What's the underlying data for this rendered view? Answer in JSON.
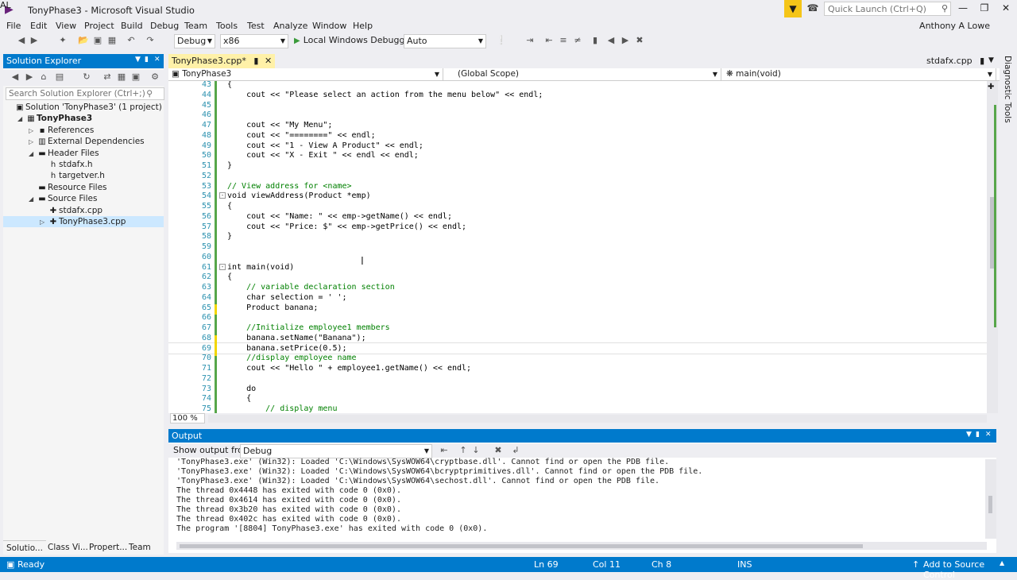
{
  "window": {
    "title": "TonyPhase3 - Microsoft Visual Studio",
    "quick_launch_placeholder": "Quick Launch (Ctrl+Q)",
    "user": "Anthony A Lowe",
    "user_initials": "AL"
  },
  "menu": [
    "File",
    "Edit",
    "View",
    "Project",
    "Build",
    "Debug",
    "Team",
    "Tools",
    "Test",
    "Analyze",
    "Window",
    "Help"
  ],
  "toolbar": {
    "config": "Debug",
    "platform": "x86",
    "debugger": "Local Windows Debugger",
    "debugger_mode": "Auto"
  },
  "solution_explorer": {
    "title": "Solution Explorer",
    "search_placeholder": "Search Solution Explorer (Ctrl+;)",
    "tree": [
      {
        "label": "Solution 'TonyPhase3' (1 project)",
        "icon": "solution-icon",
        "level": 0,
        "expander": ""
      },
      {
        "label": "TonyPhase3",
        "icon": "project-icon",
        "level": 1,
        "expander": "open",
        "bold": true
      },
      {
        "label": "References",
        "icon": "references-icon",
        "level": 2,
        "expander": "closed"
      },
      {
        "label": "External Dependencies",
        "icon": "dependencies-icon",
        "level": 2,
        "expander": "closed"
      },
      {
        "label": "Header Files",
        "icon": "folder-icon",
        "level": 2,
        "expander": "open"
      },
      {
        "label": "stdafx.h",
        "icon": "header-file-icon",
        "level": 3,
        "expander": ""
      },
      {
        "label": "targetver.h",
        "icon": "header-file-icon",
        "level": 3,
        "expander": ""
      },
      {
        "label": "Resource Files",
        "icon": "folder-icon",
        "level": 2,
        "expander": ""
      },
      {
        "label": "Source Files",
        "icon": "folder-icon",
        "level": 2,
        "expander": "open"
      },
      {
        "label": "stdafx.cpp",
        "icon": "cpp-file-icon",
        "level": 3,
        "expander": ""
      },
      {
        "label": "TonyPhase3.cpp",
        "icon": "cpp-file-icon",
        "level": 3,
        "expander": "closed",
        "selected": true
      }
    ],
    "bottom_tabs": [
      "Solutio...",
      "Class Vi...",
      "Propert...",
      "Team E..."
    ]
  },
  "editor": {
    "active_tab": "TonyPhase3.cpp*",
    "right_tab": "stdafx.cpp",
    "nav_project": "TonyPhase3",
    "nav_scope": "(Global Scope)",
    "nav_member": "main(void)",
    "zoom": "100 %",
    "lines": [
      {
        "n": "43",
        "code": "{"
      },
      {
        "n": "44",
        "code": "    cout << \"Please select an action from the menu below\" << endl;"
      },
      {
        "n": "45",
        "code": ""
      },
      {
        "n": "46",
        "code": ""
      },
      {
        "n": "47",
        "code": "    cout << \"My Menu\";"
      },
      {
        "n": "48",
        "code": "    cout << \"========\" << endl;"
      },
      {
        "n": "49",
        "code": "    cout << \"1 - View A Product\" << endl;"
      },
      {
        "n": "50",
        "code": "    cout << \"X - Exit \" << endl << endl;"
      },
      {
        "n": "51",
        "code": "}"
      },
      {
        "n": "52",
        "code": ""
      },
      {
        "n": "53",
        "code": "// View address for <name>"
      },
      {
        "n": "54",
        "code": "void viewAddress(Product *emp)"
      },
      {
        "n": "55",
        "code": "{"
      },
      {
        "n": "56",
        "code": "    cout << \"Name: \" << emp->getName() << endl;"
      },
      {
        "n": "57",
        "code": "    cout << \"Price: $\" << emp->getPrice() << endl;"
      },
      {
        "n": "58",
        "code": "}"
      },
      {
        "n": "59",
        "code": ""
      },
      {
        "n": "60",
        "code": ""
      },
      {
        "n": "61",
        "code": "int main(void)"
      },
      {
        "n": "62",
        "code": "{"
      },
      {
        "n": "63",
        "code": "    // variable declaration section"
      },
      {
        "n": "64",
        "code": "    char selection = ' ';"
      },
      {
        "n": "65",
        "code": "    Product banana;"
      },
      {
        "n": "66",
        "code": ""
      },
      {
        "n": "67",
        "code": "    //Initialize employee1 members"
      },
      {
        "n": "68",
        "code": "    banana.setName(\"Banana\");"
      },
      {
        "n": "69",
        "code": "    banana.setPrice(0.5);"
      },
      {
        "n": "70",
        "code": "    //display employee name"
      },
      {
        "n": "71",
        "code": "    cout << \"Hello \" + employee1.getName() << endl;"
      },
      {
        "n": "72",
        "code": ""
      },
      {
        "n": "73",
        "code": "    do"
      },
      {
        "n": "74",
        "code": "    {"
      },
      {
        "n": "75",
        "code": "        // display menu"
      }
    ]
  },
  "output": {
    "title": "Output",
    "show_from_label": "Show output from:",
    "source": "Debug",
    "lines": [
      "'TonyPhase3.exe' (Win32): Loaded 'C:\\Windows\\SysWOW64\\cryptbase.dll'. Cannot find or open the PDB file.",
      "'TonyPhase3.exe' (Win32): Loaded 'C:\\Windows\\SysWOW64\\bcryptprimitives.dll'. Cannot find or open the PDB file.",
      "'TonyPhase3.exe' (Win32): Loaded 'C:\\Windows\\SysWOW64\\sechost.dll'. Cannot find or open the PDB file.",
      "The thread 0x4448 has exited with code 0 (0x0).",
      "The thread 0x4614 has exited with code 0 (0x0).",
      "The thread 0x3b20 has exited with code 0 (0x0).",
      "The thread 0x402c has exited with code 0 (0x0).",
      "The program '[8804] TonyPhase3.exe' has exited with code 0 (0x0)."
    ]
  },
  "side_panel": {
    "label": "Diagnostic Tools"
  },
  "status": {
    "state": "Ready",
    "line": "Ln 69",
    "col": "Col 11",
    "ch": "Ch 8",
    "mode": "INS",
    "source_control": "Add to Source Control"
  },
  "colors": {
    "accent": "#007acc",
    "tab_modified": "#fff1a8",
    "selection": "#cce8ff",
    "change_saved": "#57a64a",
    "change_unsaved": "#f2d600"
  }
}
